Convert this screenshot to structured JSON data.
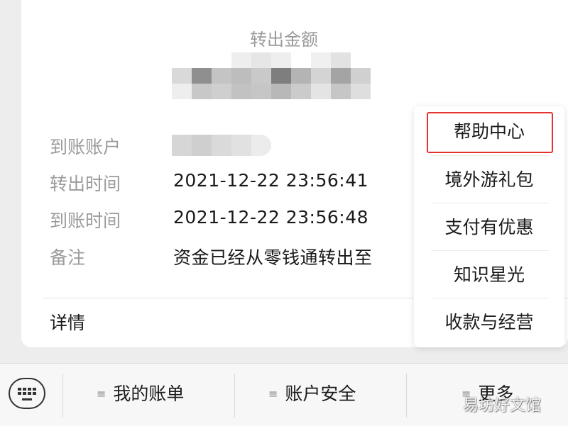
{
  "transfer": {
    "amount_label": "转出金额",
    "amount_value": "",
    "details": [
      {
        "label": "到账账户",
        "value": ""
      },
      {
        "label": "转出时间",
        "value": "2021-12-22 23:56:41"
      },
      {
        "label": "到账时间",
        "value": "2021-12-22 23:56:48"
      },
      {
        "label": "备注",
        "value": "资金已经从零钱通转出至"
      }
    ],
    "details_link": "详情"
  },
  "more_menu": {
    "items": [
      "帮助中心",
      "境外游礼包",
      "支付有优惠",
      "知识星光",
      "收款与经营"
    ],
    "highlighted_item": "帮助中心",
    "highlight_color": "#e8322f"
  },
  "bottom_bar": {
    "keyboard_icon": "keyboard-icon",
    "tabs": [
      {
        "label": "我的账单",
        "icon": "menu-lines-icon"
      },
      {
        "label": "账户安全",
        "icon": "menu-lines-icon"
      },
      {
        "label": "更多",
        "icon": "menu-lines-icon"
      }
    ]
  },
  "watermark": "易坊好文馆"
}
